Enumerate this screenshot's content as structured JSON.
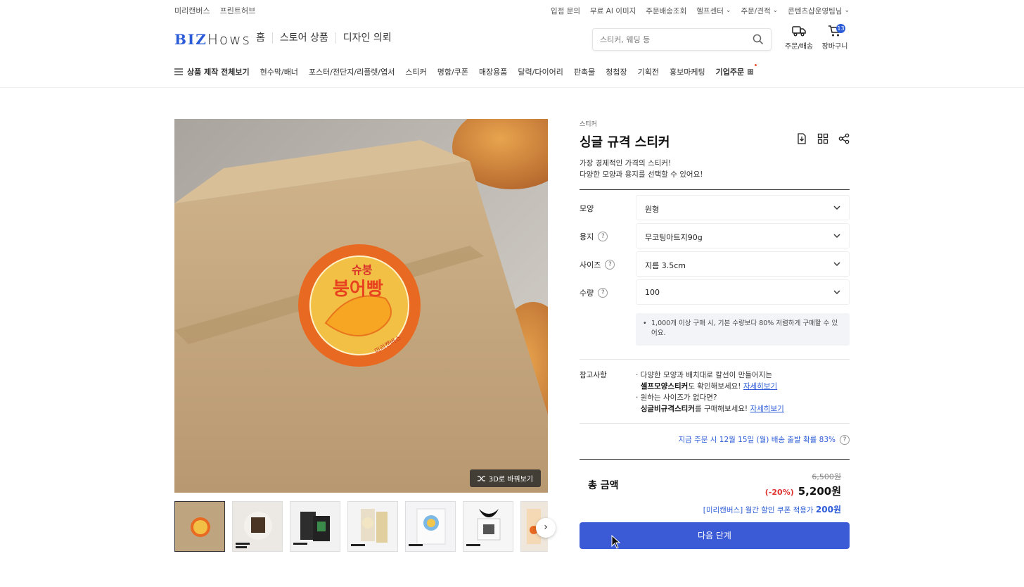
{
  "util": {
    "left": [
      "미리캔버스",
      "프린트허브"
    ],
    "right": [
      "입점 문의",
      "무료 AI 이미지",
      "주문배송조회"
    ],
    "right_dd": [
      "헬프센터",
      "주문/견적",
      "콘텐츠샵운영팀님"
    ]
  },
  "header": {
    "logo_b": "BIZ",
    "logo_h": "Hows",
    "nav": [
      "홈",
      "스토어 상품",
      "디자인 의뢰"
    ],
    "search_placeholder": "스티커, 웨딩 등",
    "orders_label": "주문/배송",
    "cart_label": "장바구니",
    "cart_count": "13"
  },
  "categories": {
    "all": "상품 제작 전체보기",
    "items": [
      "현수막/배너",
      "포스터/전단지/리플렛/엽서",
      "스티커",
      "명함/쿠폰",
      "매장용품",
      "달력/다이어리",
      "판촉물",
      "청첩장",
      "기획전",
      "홍보마케팅"
    ],
    "corporate": "기업주문"
  },
  "gallery": {
    "view3d": "3D로 바꿔보기",
    "sticker_top": "슈붕",
    "sticker_main": "붕어빵",
    "sticker_sub": "미리캔버스"
  },
  "product": {
    "category": "스티커",
    "title": "싱글 규격 스티커",
    "desc1": "가장 경제적인 가격의 스티커!",
    "desc2": "다양한 모양과 용지를 선택할 수 있어요!",
    "options": [
      {
        "label": "모양",
        "value": "원형"
      },
      {
        "label": "용지",
        "value": "무코팅아트지90g"
      },
      {
        "label": "사이즈",
        "value": "지름 3.5cm"
      },
      {
        "label": "수량",
        "value": "100"
      }
    ],
    "note": "1,000개 이상 구매 시, 기본 수량보다 80% 저렴하게 구매할 수 있어요.",
    "ref_label": "참고사항",
    "ref1": "· 다양한 모양과 배치대로 칼선이 만들어지는",
    "ref2_bold": "셀프모양스티커",
    "ref2_rest": "도 확인해보세요! ",
    "ref3": "· 원하는 사이즈가 없다면?",
    "ref4_bold": "싱글비규격스티커",
    "ref4_rest": "를 구매해보세요! ",
    "ref_link": "자세히보기",
    "shipping": "지금 주문 시 12월 15일 (월) 배송 출발 확률 83%",
    "total_label": "총 금액",
    "original_price": "6,500원",
    "discount_pct": "(-20%)",
    "final_price": "5,200원",
    "coupon_text": "[미리캔버스] 월간 할인 쿠폰 적용가",
    "coupon_value": "200원",
    "next_button": "다음 단계"
  }
}
